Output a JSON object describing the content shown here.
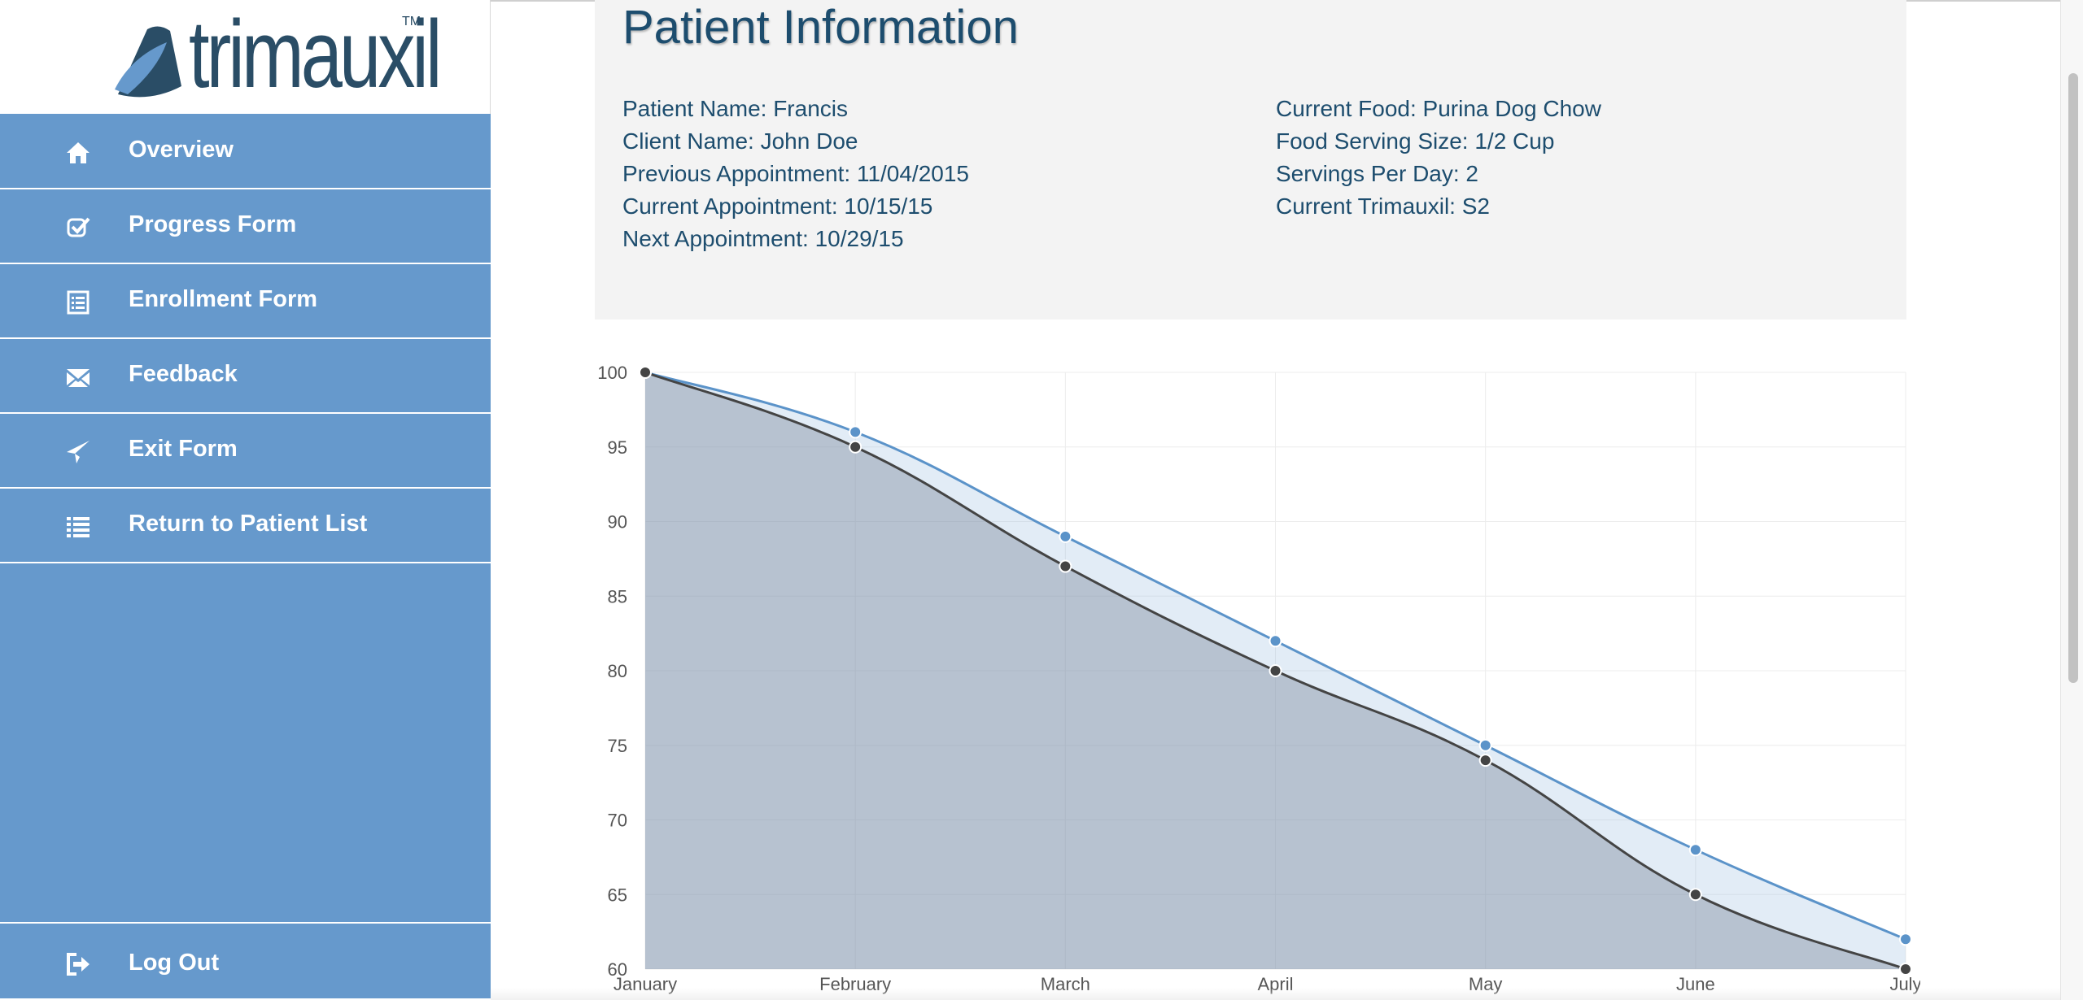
{
  "brand": {
    "name": "trimauxil",
    "trademark": "TM"
  },
  "nav": {
    "items": [
      {
        "label": "Overview",
        "icon": "home-icon"
      },
      {
        "label": "Progress Form",
        "icon": "check-square-icon"
      },
      {
        "label": "Enrollment Form",
        "icon": "list-alt-icon"
      },
      {
        "label": "Feedback",
        "icon": "envelope-icon"
      },
      {
        "label": "Exit Form",
        "icon": "send-icon"
      },
      {
        "label": "Return to Patient List",
        "icon": "list-icon"
      }
    ],
    "logout": {
      "label": "Log Out",
      "icon": "log-out-icon"
    }
  },
  "patient": {
    "title": "Patient Information",
    "left": [
      "Patient Name: Francis",
      "Client Name: John Doe",
      "Previous Appointment: 11/04/2015",
      "Current Appointment: 10/15/15",
      "Next Appointment: 10/29/15"
    ],
    "right": [
      "Current Food: Purina Dog Chow",
      "Food Serving Size: 1/2 Cup",
      "Servings Per Day: 2",
      "Current Trimauxil: S2"
    ]
  },
  "colors": {
    "sidebar": "#6699cc",
    "title_text": "#1d4d6e",
    "series_blue": "#5b93c9",
    "series_dark": "#444444"
  },
  "chart_data": {
    "type": "area",
    "categories": [
      "January",
      "February",
      "March",
      "April",
      "May",
      "June",
      "July"
    ],
    "series": [
      {
        "values": [
          100,
          96,
          89,
          82,
          75,
          68,
          62
        ],
        "color": "#5b93c9"
      },
      {
        "values": [
          100,
          95,
          87,
          80,
          74,
          65,
          60
        ],
        "color": "#444444"
      }
    ],
    "ylim": [
      60,
      100
    ],
    "yticks": [
      100,
      95,
      90,
      85,
      80,
      75,
      70,
      65,
      60
    ],
    "grid": true,
    "title": "",
    "xlabel": "",
    "ylabel": ""
  }
}
